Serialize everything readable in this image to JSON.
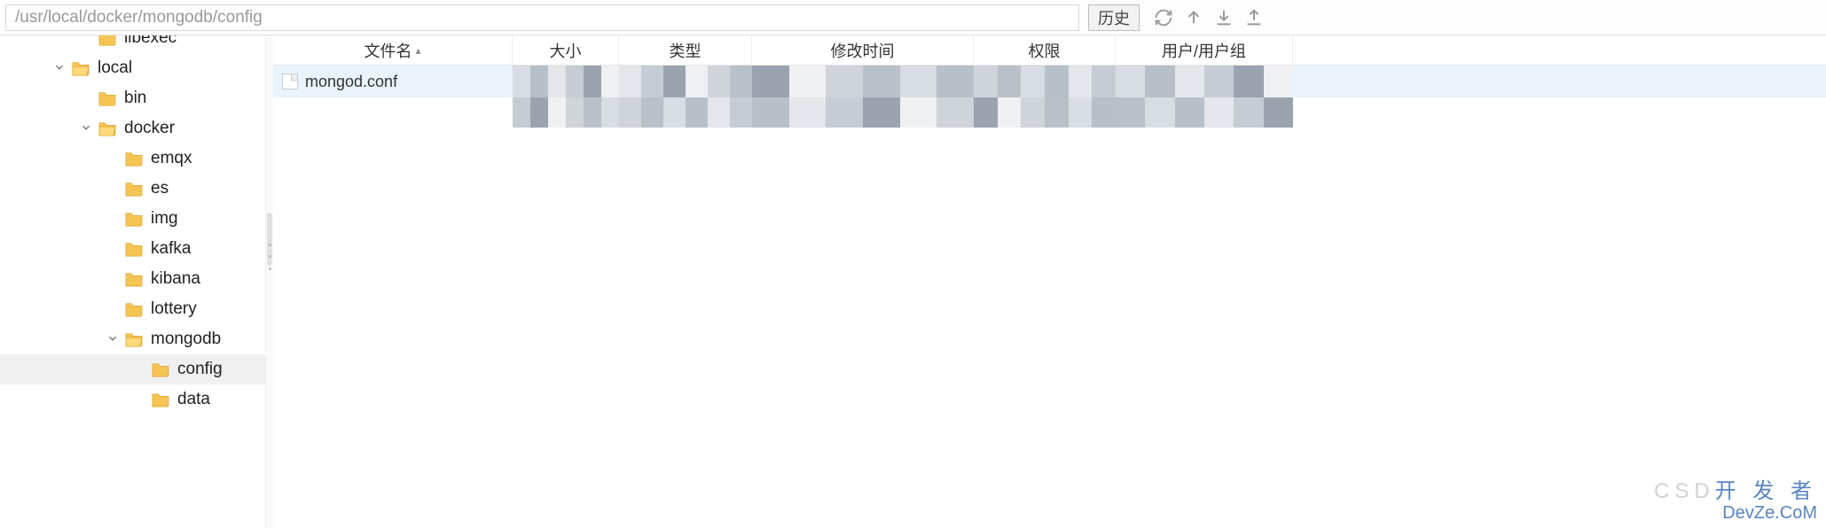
{
  "toolbar": {
    "path": "/usr/local/docker/mongodb/config",
    "history_label": "历史",
    "icons": [
      "refresh",
      "upload-arrow",
      "download",
      "upload-tray"
    ]
  },
  "tree": {
    "items": [
      {
        "label": "libexec",
        "depth": 2,
        "expandable": false,
        "expanded": false,
        "partial": true
      },
      {
        "label": "local",
        "depth": 1,
        "expandable": true,
        "expanded": true
      },
      {
        "label": "bin",
        "depth": 2,
        "expandable": false,
        "expanded": false
      },
      {
        "label": "docker",
        "depth": 2,
        "expandable": true,
        "expanded": true
      },
      {
        "label": "emqx",
        "depth": 3,
        "expandable": false,
        "expanded": false
      },
      {
        "label": "es",
        "depth": 3,
        "expandable": false,
        "expanded": false
      },
      {
        "label": "img",
        "depth": 3,
        "expandable": false,
        "expanded": false
      },
      {
        "label": "kafka",
        "depth": 3,
        "expandable": false,
        "expanded": false
      },
      {
        "label": "kibana",
        "depth": 3,
        "expandable": false,
        "expanded": false
      },
      {
        "label": "lottery",
        "depth": 3,
        "expandable": false,
        "expanded": false
      },
      {
        "label": "mongodb",
        "depth": 3,
        "expandable": true,
        "expanded": true
      },
      {
        "label": "config",
        "depth": 4,
        "expandable": false,
        "expanded": false,
        "selected": true
      },
      {
        "label": "data",
        "depth": 4,
        "expandable": false,
        "expanded": false
      }
    ]
  },
  "table": {
    "columns": {
      "name": "文件名",
      "size": "大小",
      "type": "类型",
      "mtime": "修改时间",
      "perm": "权限",
      "user": "用户/用户组"
    },
    "sort_indicator": "▴",
    "rows": [
      {
        "name": "mongod.conf",
        "selected": true
      }
    ]
  },
  "watermark": {
    "line1_a": "CSD",
    "line1_b": "开 发 者",
    "line2": "DevZe.CoM"
  },
  "colors": {
    "pixelated": [
      "#d8dce3",
      "#b7bfc9",
      "#e3e6ea",
      "#c6ccd4",
      "#9aa3ae",
      "#eef0f3",
      "#cfd3da",
      "#bac0c8"
    ]
  }
}
